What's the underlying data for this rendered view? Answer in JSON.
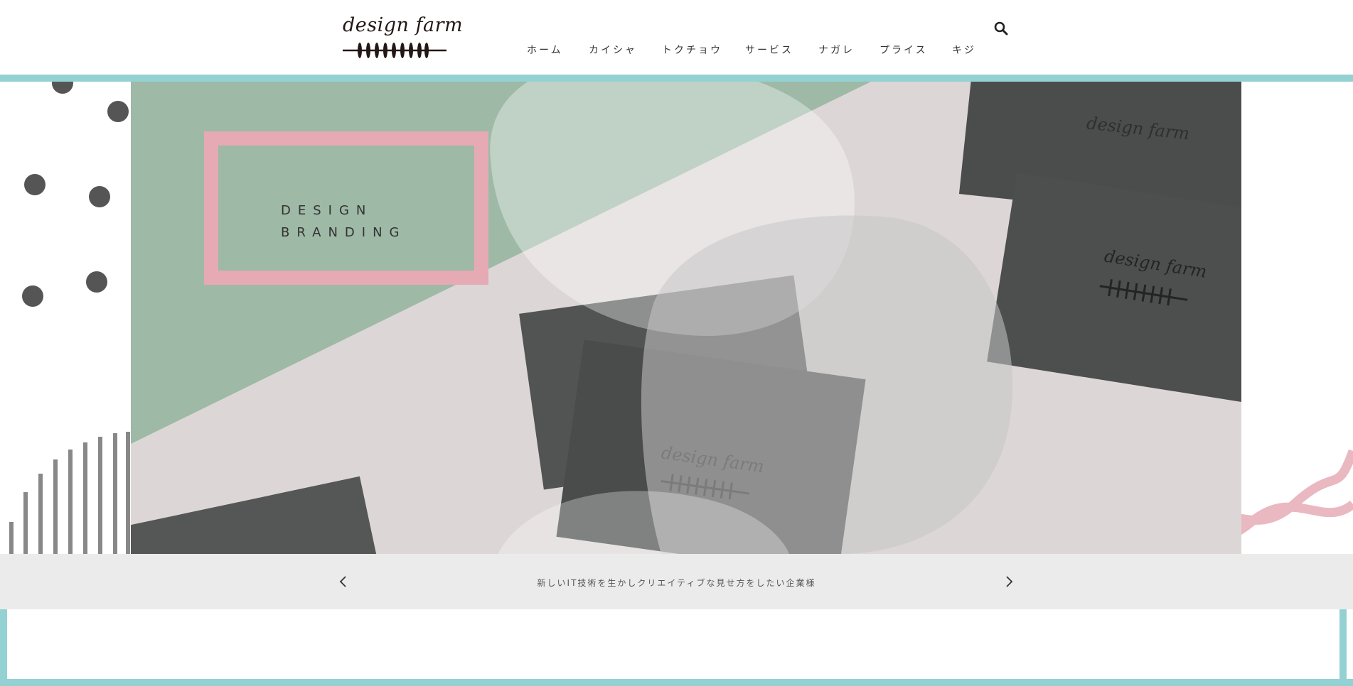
{
  "logo": {
    "text": "design farm"
  },
  "nav": {
    "items": [
      {
        "label": "ホーム"
      },
      {
        "label": "カイシャ"
      },
      {
        "label": "トクチョウ"
      },
      {
        "label": "サービス"
      },
      {
        "label": "ナガレ"
      },
      {
        "label": "プライス"
      },
      {
        "label": "キジ"
      }
    ]
  },
  "search": {
    "icon": "search-icon"
  },
  "hero": {
    "title_line1": "DESIGN",
    "title_line2": "BRANDING",
    "card_logo_text": "design farm"
  },
  "slider": {
    "caption": "新しいIT技術を生かしクリエイティブな見せ方をしたい企業様",
    "prev_icon": "chevron-left-icon",
    "next_icon": "chevron-right-icon"
  },
  "colors": {
    "accent_teal": "#94d1d2",
    "sage_green": "#9eb9a6",
    "pink": "#e5aab4",
    "card_dark": "#4b4d4c",
    "caption_bg": "#ebebeb"
  }
}
